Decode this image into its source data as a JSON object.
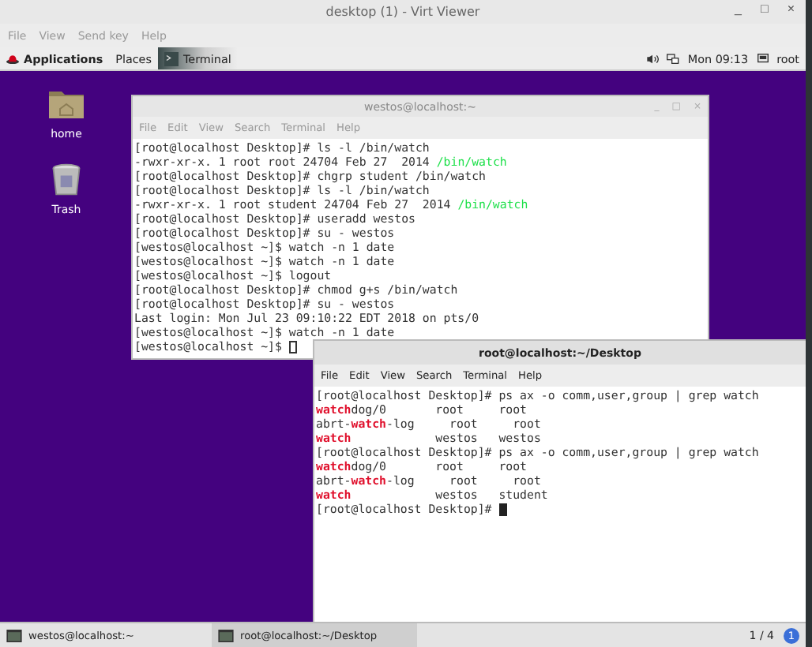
{
  "window": {
    "title": "desktop (1) - Virt Viewer",
    "controls": [
      "_",
      "□",
      "×"
    ]
  },
  "menu": [
    "File",
    "View",
    "Send key",
    "Help"
  ],
  "top_bar": {
    "items": [
      {
        "label": "Applications",
        "kind": "apps"
      },
      {
        "label": "Places",
        "kind": "places"
      },
      {
        "label": "Terminal",
        "kind": "app"
      }
    ],
    "clock": "Mon 09:13",
    "user": "root"
  },
  "desktop_icons": [
    {
      "label": "home",
      "kind": "folder"
    },
    {
      "label": "Trash",
      "kind": "trash"
    }
  ],
  "terminals": [
    {
      "title": "westos@localhost:~",
      "focused": false,
      "controls": [
        "_",
        "□",
        "×"
      ],
      "menu": [
        "File",
        "Edit",
        "View",
        "Search",
        "Terminal",
        "Help"
      ],
      "lines": [
        [
          {
            "text": "[root@localhost Desktop]# ls -l /bin/watch",
            "kind": "plain"
          }
        ],
        [
          {
            "text": "-rwxr-xr-x. 1 root root 24704 Feb 27  2014 ",
            "kind": "plain"
          },
          {
            "text": "/bin/watch",
            "kind": "path"
          }
        ],
        [
          {
            "text": "[root@localhost Desktop]# chgrp student /bin/watch",
            "kind": "plain"
          }
        ],
        [
          {
            "text": "[root@localhost Desktop]# ls -l /bin/watch",
            "kind": "plain"
          }
        ],
        [
          {
            "text": "-rwxr-xr-x. 1 root student 24704 Feb 27  2014 ",
            "kind": "plain"
          },
          {
            "text": "/bin/watch",
            "kind": "path"
          }
        ],
        [
          {
            "text": "[root@localhost Desktop]# useradd westos",
            "kind": "plain"
          }
        ],
        [
          {
            "text": "[root@localhost Desktop]# su - westos",
            "kind": "plain"
          }
        ],
        [
          {
            "text": "[westos@localhost ~]$ watch -n 1 date",
            "kind": "plain"
          }
        ],
        [
          {
            "text": "[westos@localhost ~]$ watch -n 1 date",
            "kind": "plain"
          }
        ],
        [
          {
            "text": "[westos@localhost ~]$ logout",
            "kind": "plain"
          }
        ],
        [
          {
            "text": "[root@localhost Desktop]# chmod g+s /bin/watch",
            "kind": "plain"
          }
        ],
        [
          {
            "text": "[root@localhost Desktop]# su - westos",
            "kind": "plain"
          }
        ],
        [
          {
            "text": "Last login: Mon Jul 23 09:10:22 EDT 2018 on pts/0",
            "kind": "plain"
          }
        ],
        [
          {
            "text": "[westos@localhost ~]$ watch -n 1 date",
            "kind": "plain"
          }
        ],
        [
          {
            "text": "[westos@localhost ~]$ ",
            "kind": "plain"
          }
        ]
      ]
    },
    {
      "title": "root@localhost:~/Desktop",
      "focused": true,
      "menu": [
        "File",
        "Edit",
        "View",
        "Search",
        "Terminal",
        "Help"
      ],
      "lines": [
        [
          {
            "text": "[root@localhost Desktop]# ps ax -o comm,user,group | grep watch",
            "kind": "plain"
          }
        ],
        [
          {
            "text": "watch",
            "kind": "match"
          },
          {
            "text": "dog/0       root     root",
            "kind": "plain"
          }
        ],
        [
          {
            "text": "abrt-",
            "kind": "plain"
          },
          {
            "text": "watch",
            "kind": "match"
          },
          {
            "text": "-log     root     root",
            "kind": "plain"
          }
        ],
        [
          {
            "text": "watch",
            "kind": "match"
          },
          {
            "text": "            westos   westos",
            "kind": "plain"
          }
        ],
        [
          {
            "text": "[root@localhost Desktop]# ps ax -o comm,user,group | grep watch",
            "kind": "plain"
          }
        ],
        [
          {
            "text": "watch",
            "kind": "match"
          },
          {
            "text": "dog/0       root     root",
            "kind": "plain"
          }
        ],
        [
          {
            "text": "abrt-",
            "kind": "plain"
          },
          {
            "text": "watch",
            "kind": "match"
          },
          {
            "text": "-log     root     root",
            "kind": "plain"
          }
        ],
        [
          {
            "text": "watch",
            "kind": "match"
          },
          {
            "text": "            westos   student",
            "kind": "plain"
          }
        ],
        [
          {
            "text": "[root@localhost Desktop]# ",
            "kind": "plain"
          }
        ]
      ]
    }
  ],
  "taskbar": {
    "items": [
      {
        "label": "westos@localhost:~",
        "selected": false
      },
      {
        "label": "root@localhost:~/Desktop",
        "selected": true
      }
    ],
    "workspace": "1 / 4",
    "notifications": "1"
  }
}
